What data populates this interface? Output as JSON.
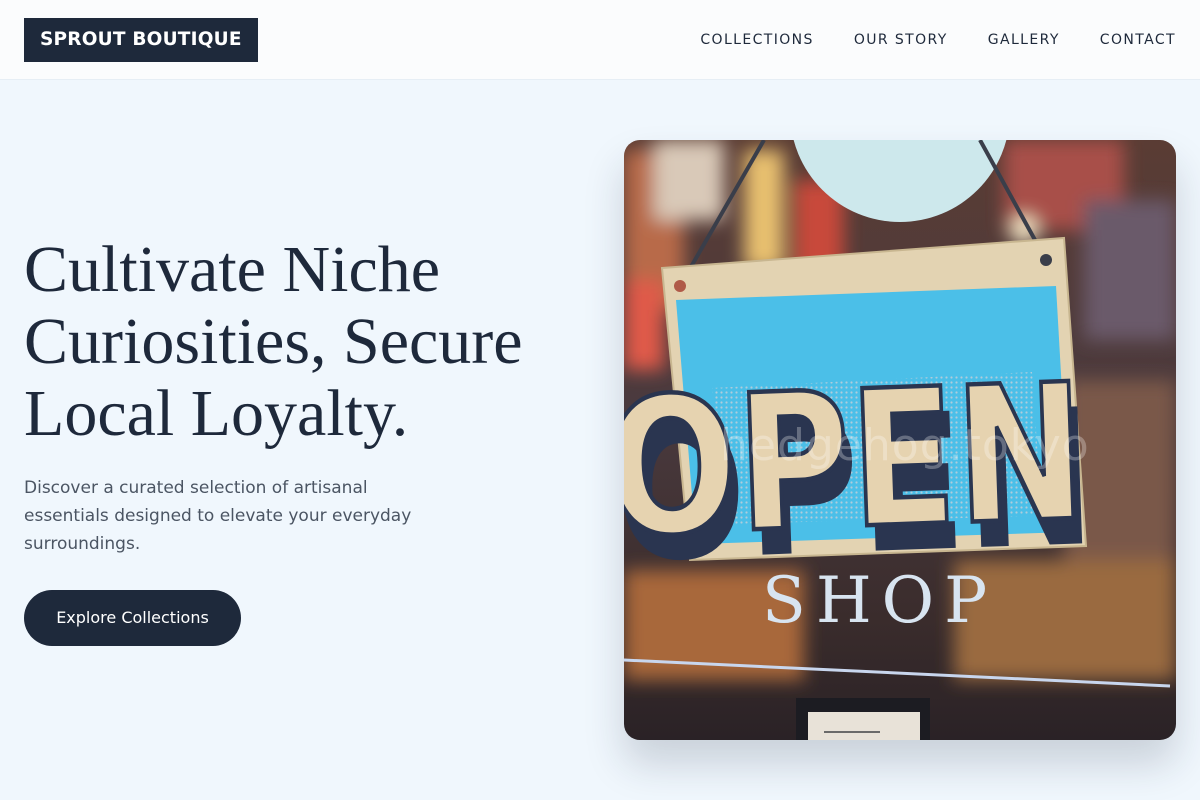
{
  "brand": {
    "name": "SPROUT BOUTIQUE"
  },
  "nav": {
    "items": [
      "COLLECTIONS",
      "OUR STORY",
      "GALLERY",
      "CONTACT"
    ]
  },
  "hero": {
    "title_lines": [
      "Cultivate Niche",
      "Curiosities, Secure",
      "Local Loyalty."
    ],
    "subtitle_lines": [
      "Discover a curated selection of artisanal",
      "essentials designed to elevate your everyday",
      "surroundings."
    ],
    "cta_label": "Explore Collections"
  },
  "image": {
    "sign_text": "OPEN",
    "window_text": "SHOP",
    "watermark": "hedgehog.tokyo"
  },
  "colors": {
    "brand": "#1e293b",
    "background": "#f0f7fd",
    "sign_blue": "#4bbfe8"
  }
}
